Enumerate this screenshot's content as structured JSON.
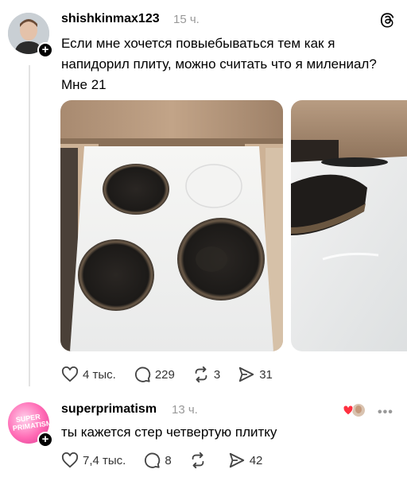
{
  "post": {
    "username": "shishkinmax123",
    "time": "15 ч.",
    "text": "Если мне хочется повыебываться тем как я напидорил плиту, можно считать что я милениал? Мне 21",
    "actions": {
      "likes": "4 тыс.",
      "comments": "229",
      "reposts": "3",
      "shares": "31"
    }
  },
  "reply": {
    "username": "superprimatism",
    "time": "13 ч.",
    "text": "ты кажется стер четвертую плитку",
    "avatar_text": "SUPER PRIMATISM",
    "actions": {
      "likes": "7,4 тыс.",
      "comments": "8",
      "reposts": "",
      "shares": "42"
    }
  },
  "icons": {
    "logo": "threads-logo-icon",
    "follow": "plus-icon",
    "like": "heart-icon",
    "comment": "comment-icon",
    "repost": "repost-icon",
    "share": "share-icon",
    "more": "more-icon"
  },
  "colors": {
    "heart_red": "#ff3040",
    "muted": "#999999",
    "thread_line": "#e3e3e3"
  }
}
